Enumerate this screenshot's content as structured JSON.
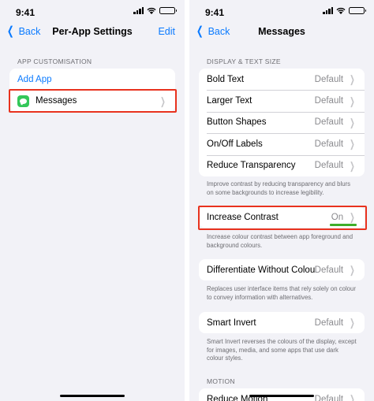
{
  "status": {
    "time": "9:41"
  },
  "left": {
    "nav": {
      "back_label": "Back",
      "title": "Per-App Settings",
      "edit_label": "Edit"
    },
    "section_header": "APP CUSTOMISATION",
    "add_app_label": "Add App",
    "app_row": {
      "label": "Messages",
      "icon": "messages-icon"
    }
  },
  "right": {
    "nav": {
      "back_label": "Back",
      "title": "Messages"
    },
    "display_header": "DISPLAY & TEXT SIZE",
    "display_rows": [
      {
        "label": "Bold Text",
        "value": "Default"
      },
      {
        "label": "Larger Text",
        "value": "Default"
      },
      {
        "label": "Button Shapes",
        "value": "Default"
      },
      {
        "label": "On/Off Labels",
        "value": "Default"
      },
      {
        "label": "Reduce Transparency",
        "value": "Default"
      }
    ],
    "transparency_footer": "Improve contrast by reducing transparency and blurs on some backgrounds to increase legibility.",
    "contrast_row": {
      "label": "Increase Contrast",
      "value": "On"
    },
    "contrast_footer": "Increase colour contrast between app foreground and background colours.",
    "differentiate_row": {
      "label": "Differentiate Without Colour",
      "value": "Default"
    },
    "differentiate_footer": "Replaces user interface items that rely solely on colour to convey information with alternatives.",
    "invert_row": {
      "label": "Smart Invert",
      "value": "Default"
    },
    "invert_footer": "Smart Invert reverses the colours of the display, except for images, media, and some apps that use dark colour styles.",
    "motion_header": "MOTION",
    "motion_row": {
      "label": "Reduce Motion",
      "value": "Default"
    }
  },
  "colors": {
    "accent": "#0a7aff",
    "highlight": "#e8321e",
    "messages_green": "#34c759",
    "underline_green": "#3fae2a"
  }
}
